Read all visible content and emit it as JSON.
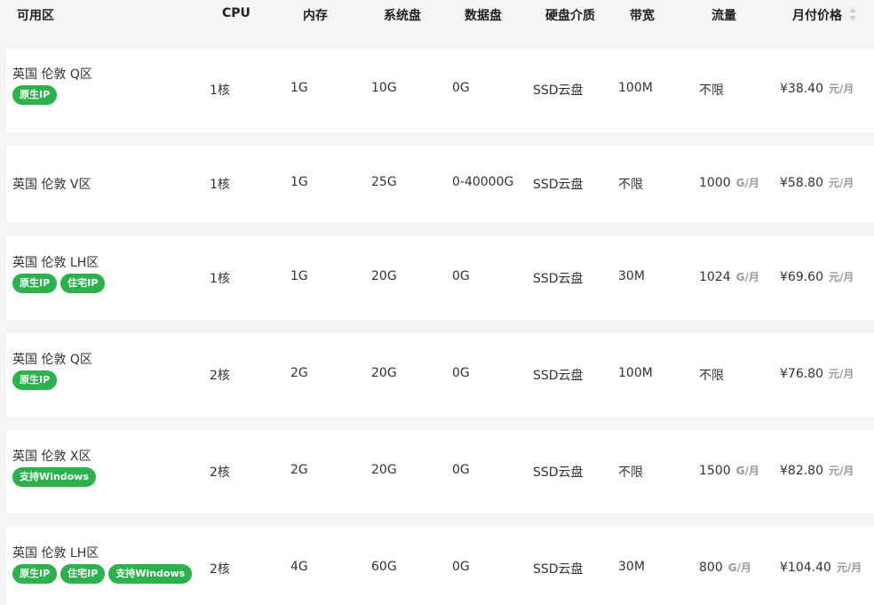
{
  "columns": {
    "zone": "可用区",
    "cpu": "CPU",
    "memory": "内存",
    "system_disk": "系统盘",
    "data_disk": "数据盘",
    "disk_type": "硬盘介质",
    "bandwidth": "带宽",
    "traffic": "流量",
    "price": "月付价格"
  },
  "rows": [
    {
      "zone": "英国 伦敦 Q区",
      "tags": [
        "原生IP"
      ],
      "cpu": "1核",
      "memory": "1G",
      "system_disk": "10G",
      "data_disk": "0G",
      "disk_type": "SSD云盘",
      "bandwidth": "100M",
      "traffic": "不限",
      "traffic_unit": "",
      "price": "¥38.40",
      "price_unit": "元/月"
    },
    {
      "zone": "英国 伦敦 V区",
      "tags": [],
      "cpu": "1核",
      "memory": "1G",
      "system_disk": "25G",
      "data_disk": "0-40000G",
      "disk_type": "SSD云盘",
      "bandwidth": "不限",
      "traffic": "1000",
      "traffic_unit": "G/月",
      "price": "¥58.80",
      "price_unit": "元/月"
    },
    {
      "zone": "英国 伦敦 LH区",
      "tags": [
        "原生IP",
        "住宅IP"
      ],
      "cpu": "1核",
      "memory": "1G",
      "system_disk": "20G",
      "data_disk": "0G",
      "disk_type": "SSD云盘",
      "bandwidth": "30M",
      "traffic": "1024",
      "traffic_unit": "G/月",
      "price": "¥69.60",
      "price_unit": "元/月"
    },
    {
      "zone": "英国 伦敦 Q区",
      "tags": [
        "原生IP"
      ],
      "cpu": "2核",
      "memory": "2G",
      "system_disk": "20G",
      "data_disk": "0G",
      "disk_type": "SSD云盘",
      "bandwidth": "100M",
      "traffic": "不限",
      "traffic_unit": "",
      "price": "¥76.80",
      "price_unit": "元/月"
    },
    {
      "zone": "英国 伦敦 X区",
      "tags": [
        "支持Windows"
      ],
      "cpu": "2核",
      "memory": "2G",
      "system_disk": "20G",
      "data_disk": "0G",
      "disk_type": "SSD云盘",
      "bandwidth": "不限",
      "traffic": "1500",
      "traffic_unit": "G/月",
      "price": "¥82.80",
      "price_unit": "元/月"
    },
    {
      "zone": "英国 伦敦 LH区",
      "tags": [
        "原生IP",
        "住宅IP",
        "支持Windows"
      ],
      "cpu": "2核",
      "memory": "4G",
      "system_disk": "60G",
      "data_disk": "0G",
      "disk_type": "SSD云盘",
      "bandwidth": "30M",
      "traffic": "800",
      "traffic_unit": "G/月",
      "price": "¥104.40",
      "price_unit": "元/月"
    }
  ],
  "colors": {
    "tag_bg": "#2bb24c",
    "row_bg": "#ffffff",
    "page_bg": "#f5f5f5"
  }
}
